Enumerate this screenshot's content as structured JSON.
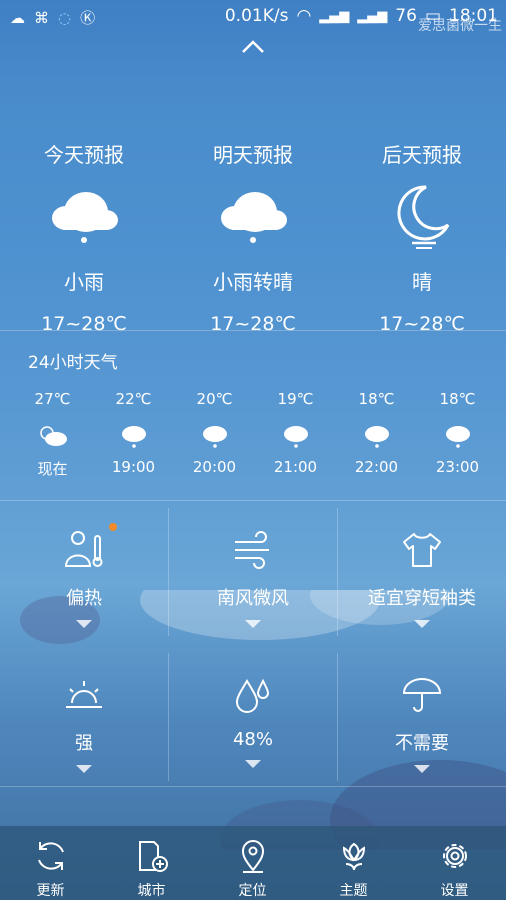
{
  "status_bar": {
    "speed": "0.01K/s",
    "battery": "76",
    "time": "18:01",
    "watermark": "爱思菌微一生"
  },
  "forecast": [
    {
      "title": "今天预报",
      "condition": "小雨",
      "temp": "17~28℃",
      "icon": "light-rain-icon"
    },
    {
      "title": "明天预报",
      "condition": "小雨转晴",
      "temp": "17~28℃",
      "icon": "light-rain-icon"
    },
    {
      "title": "后天预报",
      "condition": "晴",
      "temp": "17~28℃",
      "icon": "moon-icon"
    }
  ],
  "hourly": {
    "title": "24小时天气",
    "items": [
      {
        "temp": "27℃",
        "time": "现在",
        "icon": "partly-cloudy-icon"
      },
      {
        "temp": "22℃",
        "time": "19:00",
        "icon": "rain-cloud-icon"
      },
      {
        "temp": "20℃",
        "time": "20:00",
        "icon": "rain-cloud-icon"
      },
      {
        "temp": "19℃",
        "time": "21:00",
        "icon": "rain-cloud-icon"
      },
      {
        "temp": "18℃",
        "time": "22:00",
        "icon": "rain-cloud-icon"
      },
      {
        "temp": "18℃",
        "time": "23:00",
        "icon": "rain-cloud-icon"
      }
    ]
  },
  "indices": [
    {
      "label": "偏热",
      "icon": "body-temperature-icon"
    },
    {
      "label": "南风微风",
      "icon": "wind-icon"
    },
    {
      "label": "适宜穿短袖类",
      "icon": "tshirt-icon"
    },
    {
      "label": "强",
      "icon": "sun-uv-icon"
    },
    {
      "label": "48%",
      "icon": "humidity-icon"
    },
    {
      "label": "不需要",
      "icon": "umbrella-icon"
    }
  ],
  "nav": [
    {
      "label": "更新",
      "icon": "refresh-icon"
    },
    {
      "label": "城市",
      "icon": "add-city-icon"
    },
    {
      "label": "定位",
      "icon": "location-icon"
    },
    {
      "label": "主题",
      "icon": "theme-flower-icon"
    },
    {
      "label": "设置",
      "icon": "settings-gear-icon"
    }
  ],
  "colors": {
    "accent_dot": "#f28c2b"
  }
}
